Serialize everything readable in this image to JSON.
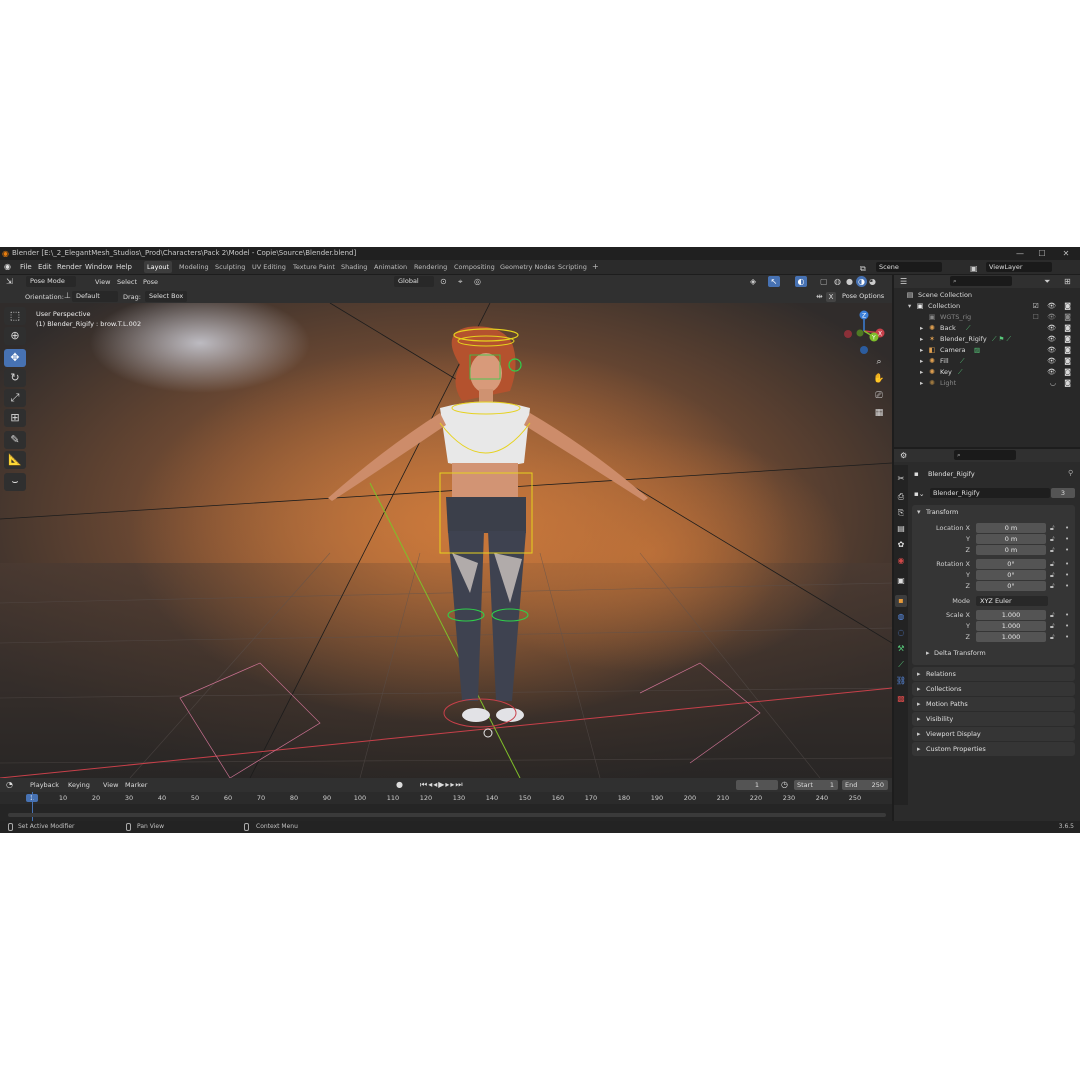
{
  "window": {
    "title": "Blender [E:\\_2_ElegantMesh_Studios\\_Prod\\Characters\\Pack 2\\Model - Copie\\Source\\Blender.blend]"
  },
  "menu": {
    "items": [
      "File",
      "Edit",
      "Render",
      "Window",
      "Help"
    ]
  },
  "workspaces": {
    "tabs": [
      "Layout",
      "Modeling",
      "Sculpting",
      "UV Editing",
      "Texture Paint",
      "Shading",
      "Animation",
      "Rendering",
      "Compositing",
      "Geometry Nodes",
      "Scripting"
    ],
    "active": "Layout",
    "add_symbol": "+"
  },
  "scene": {
    "label": "Scene"
  },
  "view_layer": {
    "label": "ViewLayer"
  },
  "viewport_header": {
    "mode": "Pose Mode",
    "menus": [
      "View",
      "Select",
      "Pose"
    ],
    "transform_orientation": "Global",
    "orientation_label": "Orientation:",
    "orientation_value": "Default",
    "drag_label": "Drag:",
    "drag_value": "Select Box",
    "pose_options": "Pose Options",
    "x_mirror": "X"
  },
  "viewport": {
    "perspective": "User Perspective",
    "active_object": "(1) Blender_Rigify : brow.T.L.002",
    "gizmo_axes": [
      "X",
      "Y",
      "Z"
    ]
  },
  "outliner": {
    "rows": [
      {
        "label": "Scene Collection",
        "icon": "scene-collection-icon"
      },
      {
        "label": "Collection",
        "icon": "collection-icon"
      },
      {
        "label": "WGTS_rig",
        "icon": "collection-icon"
      },
      {
        "label": "Back",
        "icon": "light-icon"
      },
      {
        "label": "Blender_Rigify",
        "icon": "armature-icon"
      },
      {
        "label": "Camera",
        "icon": "camera-icon"
      },
      {
        "label": "Fill",
        "icon": "light-icon"
      },
      {
        "label": "Key",
        "icon": "light-icon"
      },
      {
        "label": "Light",
        "icon": "light-icon"
      }
    ]
  },
  "properties": {
    "object_name": "Blender_Rigify",
    "data_name": "Blender_Rigify",
    "users_count": "3",
    "transform": {
      "title": "Transform",
      "location_label": "Location X",
      "location": [
        "0 m",
        "0 m",
        "0 m"
      ],
      "rotation_label": "Rotation X",
      "rotation": [
        "0°",
        "0°",
        "0°"
      ],
      "mode_label": "Mode",
      "mode_value": "XYZ Euler",
      "scale_label": "Scale X",
      "scale": [
        "1.000",
        "1.000",
        "1.000"
      ],
      "axis_y": "Y",
      "axis_z": "Z",
      "delta": "Delta Transform"
    },
    "collapsed_panels": [
      "Relations",
      "Collections",
      "Motion Paths",
      "Visibility",
      "Viewport Display",
      "Custom Properties"
    ]
  },
  "timeline": {
    "menus": [
      "Playback",
      "Keying",
      "View",
      "Marker"
    ],
    "current_frame": "1",
    "start_label": "Start",
    "start": "1",
    "end_label": "End",
    "end": "250",
    "ticks": [
      "1",
      "10",
      "20",
      "30",
      "40",
      "50",
      "60",
      "70",
      "80",
      "90",
      "100",
      "110",
      "120",
      "130",
      "140",
      "150",
      "160",
      "170",
      "180",
      "190",
      "200",
      "210",
      "220",
      "230",
      "240",
      "250"
    ]
  },
  "statusbar": {
    "hints": [
      "Set Active Modifier",
      "Pan View",
      "Context Menu"
    ],
    "version": "3.6.5"
  },
  "colors": {
    "accent": "#4772b3",
    "bone_yellow": "#e6d21e",
    "bone_green": "#2fd04a",
    "axis_x": "#c8404a",
    "axis_y": "#7fbf2a",
    "axis_z": "#3b7fd8"
  }
}
